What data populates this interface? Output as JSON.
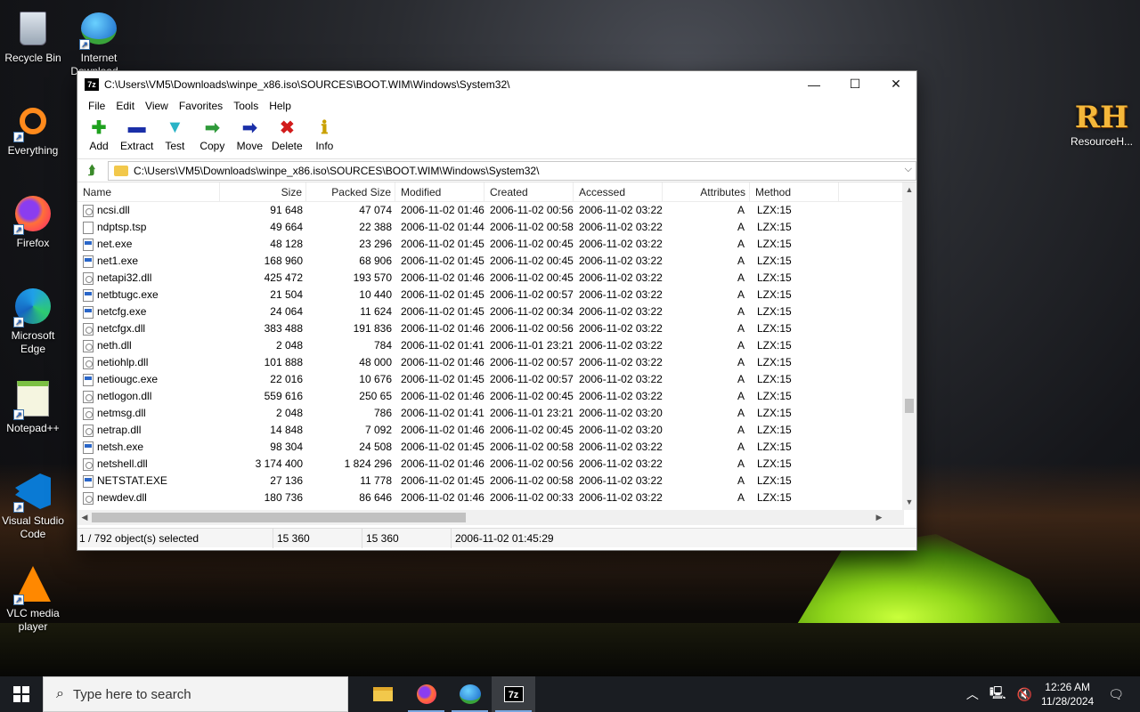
{
  "desktop": {
    "icons": [
      {
        "label": "Recycle Bin",
        "icon": "recycle-bin-icon"
      },
      {
        "label": "Internet Download...",
        "icon": "internet-download-manager-icon"
      },
      {
        "label": "Everything",
        "icon": "everything-search-icon"
      },
      {
        "label": "Firefox",
        "icon": "firefox-icon"
      },
      {
        "label": "Microsoft Edge",
        "icon": "edge-icon"
      },
      {
        "label": "Notepad++",
        "icon": "notepadpp-icon"
      },
      {
        "label": "Visual Studio Code",
        "icon": "vscode-icon"
      },
      {
        "label": "VLC media player",
        "icon": "vlc-icon"
      }
    ],
    "right_icon": {
      "label": "ResourceH...",
      "logo": "RH"
    }
  },
  "window": {
    "title": "C:\\Users\\VM5\\Downloads\\winpe_x86.iso\\SOURCES\\BOOT.WIM\\Windows\\System32\\",
    "app_icon_text": "7z",
    "controls": {
      "minimize": "—",
      "maximize": "☐",
      "close": "✕"
    },
    "menu": [
      "File",
      "Edit",
      "View",
      "Favorites",
      "Tools",
      "Help"
    ],
    "toolbar": [
      {
        "label": "Add",
        "icon": "add-icon",
        "glyph": "✚",
        "color": "#1fa11f"
      },
      {
        "label": "Extract",
        "icon": "extract-icon",
        "glyph": "▬",
        "color": "#1a2fa8"
      },
      {
        "label": "Test",
        "icon": "test-icon",
        "glyph": "▼",
        "color": "#2ab3c6"
      },
      {
        "label": "Copy",
        "icon": "copy-icon",
        "glyph": "➡",
        "color": "#2f9a3a"
      },
      {
        "label": "Move",
        "icon": "move-icon",
        "glyph": "➡",
        "color": "#1a2fa8"
      },
      {
        "label": "Delete",
        "icon": "delete-icon",
        "glyph": "✖",
        "color": "#d21b1b"
      },
      {
        "label": "Info",
        "icon": "info-icon",
        "glyph": "ℹ",
        "color": "#c9a000"
      }
    ],
    "address": "C:\\Users\\VM5\\Downloads\\winpe_x86.iso\\SOURCES\\BOOT.WIM\\Windows\\System32\\",
    "columns": [
      "Name",
      "Size",
      "Packed Size",
      "Modified",
      "Created",
      "Accessed",
      "Attributes",
      "Method"
    ],
    "rows": [
      {
        "name": "ncsi.dll",
        "type": "dll",
        "size": "91 648",
        "packed": "47 074",
        "modified": "2006-11-02 01:46",
        "created": "2006-11-02 00:56",
        "accessed": "2006-11-02 03:22",
        "attr": "A",
        "method": "LZX:15"
      },
      {
        "name": "ndptsp.tsp",
        "type": "blank",
        "size": "49 664",
        "packed": "22 388",
        "modified": "2006-11-02 01:44",
        "created": "2006-11-02 00:58",
        "accessed": "2006-11-02 03:22",
        "attr": "A",
        "method": "LZX:15"
      },
      {
        "name": "net.exe",
        "type": "exe",
        "size": "48 128",
        "packed": "23 296",
        "modified": "2006-11-02 01:45",
        "created": "2006-11-02 00:45",
        "accessed": "2006-11-02 03:22",
        "attr": "A",
        "method": "LZX:15"
      },
      {
        "name": "net1.exe",
        "type": "exe",
        "size": "168 960",
        "packed": "68 906",
        "modified": "2006-11-02 01:45",
        "created": "2006-11-02 00:45",
        "accessed": "2006-11-02 03:22",
        "attr": "A",
        "method": "LZX:15"
      },
      {
        "name": "netapi32.dll",
        "type": "dll",
        "size": "425 472",
        "packed": "193 570",
        "modified": "2006-11-02 01:46",
        "created": "2006-11-02 00:45",
        "accessed": "2006-11-02 03:22",
        "attr": "A",
        "method": "LZX:15"
      },
      {
        "name": "netbtugc.exe",
        "type": "exe",
        "size": "21 504",
        "packed": "10 440",
        "modified": "2006-11-02 01:45",
        "created": "2006-11-02 00:57",
        "accessed": "2006-11-02 03:22",
        "attr": "A",
        "method": "LZX:15"
      },
      {
        "name": "netcfg.exe",
        "type": "exe",
        "size": "24 064",
        "packed": "11 624",
        "modified": "2006-11-02 01:45",
        "created": "2006-11-02 00:34",
        "accessed": "2006-11-02 03:22",
        "attr": "A",
        "method": "LZX:15"
      },
      {
        "name": "netcfgx.dll",
        "type": "dll",
        "size": "383 488",
        "packed": "191 836",
        "modified": "2006-11-02 01:46",
        "created": "2006-11-02 00:56",
        "accessed": "2006-11-02 03:22",
        "attr": "A",
        "method": "LZX:15"
      },
      {
        "name": "neth.dll",
        "type": "dll",
        "size": "2 048",
        "packed": "784",
        "modified": "2006-11-02 01:41",
        "created": "2006-11-01 23:21",
        "accessed": "2006-11-02 03:22",
        "attr": "A",
        "method": "LZX:15"
      },
      {
        "name": "netiohlp.dll",
        "type": "dll",
        "size": "101 888",
        "packed": "48 000",
        "modified": "2006-11-02 01:46",
        "created": "2006-11-02 00:57",
        "accessed": "2006-11-02 03:22",
        "attr": "A",
        "method": "LZX:15"
      },
      {
        "name": "netiougc.exe",
        "type": "exe",
        "size": "22 016",
        "packed": "10 676",
        "modified": "2006-11-02 01:45",
        "created": "2006-11-02 00:57",
        "accessed": "2006-11-02 03:22",
        "attr": "A",
        "method": "LZX:15"
      },
      {
        "name": "netlogon.dll",
        "type": "dll",
        "size": "559 616",
        "packed": "250 65",
        "modified": "2006-11-02 01:46",
        "created": "2006-11-02 00:45",
        "accessed": "2006-11-02 03:22",
        "attr": "A",
        "method": "LZX:15"
      },
      {
        "name": "netmsg.dll",
        "type": "dll",
        "size": "2 048",
        "packed": "786",
        "modified": "2006-11-02 01:41",
        "created": "2006-11-01 23:21",
        "accessed": "2006-11-02 03:20",
        "attr": "A",
        "method": "LZX:15"
      },
      {
        "name": "netrap.dll",
        "type": "dll",
        "size": "14 848",
        "packed": "7 092",
        "modified": "2006-11-02 01:46",
        "created": "2006-11-02 00:45",
        "accessed": "2006-11-02 03:20",
        "attr": "A",
        "method": "LZX:15"
      },
      {
        "name": "netsh.exe",
        "type": "exe",
        "size": "98 304",
        "packed": "24 508",
        "modified": "2006-11-02 01:45",
        "created": "2006-11-02 00:58",
        "accessed": "2006-11-02 03:22",
        "attr": "A",
        "method": "LZX:15"
      },
      {
        "name": "netshell.dll",
        "type": "dll",
        "size": "3 174 400",
        "packed": "1 824 296",
        "modified": "2006-11-02 01:46",
        "created": "2006-11-02 00:56",
        "accessed": "2006-11-02 03:22",
        "attr": "A",
        "method": "LZX:15"
      },
      {
        "name": "NETSTAT.EXE",
        "type": "exe",
        "size": "27 136",
        "packed": "11 778",
        "modified": "2006-11-02 01:45",
        "created": "2006-11-02 00:58",
        "accessed": "2006-11-02 03:22",
        "attr": "A",
        "method": "LZX:15"
      },
      {
        "name": "newdev.dll",
        "type": "dll",
        "size": "180 736",
        "packed": "86 646",
        "modified": "2006-11-02 01:46",
        "created": "2006-11-02 00:33",
        "accessed": "2006-11-02 03:22",
        "attr": "A",
        "method": "LZX:15"
      }
    ],
    "status": {
      "selection": "1 / 792 object(s) selected",
      "size": "15 360",
      "packed": "15 360",
      "modified": "2006-11-02 01:45:29"
    }
  },
  "taskbar": {
    "search_placeholder": "Type here to search",
    "apps": [
      {
        "name": "file-explorer",
        "icon": "folder-icon"
      },
      {
        "name": "firefox",
        "icon": "firefox-icon"
      },
      {
        "name": "internet-download-manager",
        "icon": "idm-icon"
      },
      {
        "name": "7zip",
        "icon": "7zip-icon",
        "active": true
      }
    ],
    "time": "12:26 AM",
    "date": "11/28/2024"
  }
}
